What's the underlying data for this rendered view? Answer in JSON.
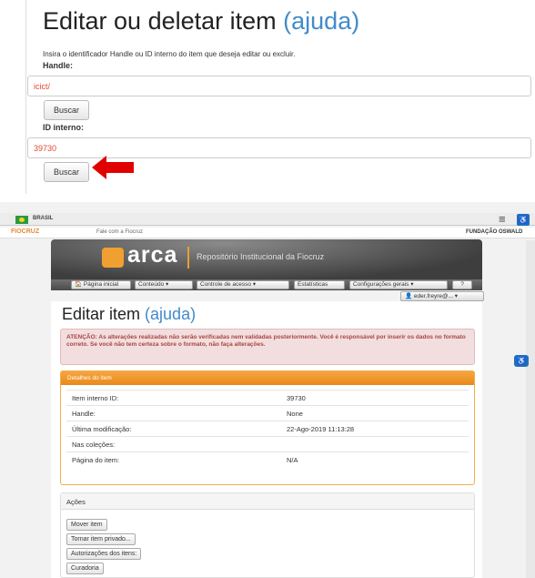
{
  "top": {
    "title": "Editar ou deletar item",
    "help": "(ajuda)",
    "intro": "Insira o identificador Handle ou ID interno do item que deseja editar ou excluir.",
    "handle_label": "Handle:",
    "handle_value": "icict/",
    "search_label": "Buscar",
    "id_label": "ID interno:",
    "id_value": "39730",
    "search2_label": "Buscar"
  },
  "govbar": {
    "country": "BRASIL"
  },
  "fiobar": {
    "logo": "FIOCRUZ",
    "contact": "Fale com a Fiocruz",
    "foundation": "FUNDAÇÃO OSWALD"
  },
  "banner": {
    "brand": "arca",
    "subtitle": "Repositório Institucional da Fiocruz"
  },
  "nav": {
    "home": "Página inicial",
    "content": "Conteúdo",
    "access": "Controle de acesso",
    "stats": "Estatísticas",
    "settings": "Configurações gerais",
    "user": "eder.freyre@..."
  },
  "page": {
    "title": "Editar item",
    "help": "(ajuda)",
    "warning": "ATENÇÃO: As alterações realizadas não serão verificadas nem validadas posteriormente. Você é responsável por inserir os dados no formato correto. Se você não tem certeza sobre o formato, não faça alterações."
  },
  "details": {
    "header": "Detalhes do item",
    "rows": [
      {
        "label": "Item interno ID:",
        "value": "39730"
      },
      {
        "label": "Handle:",
        "value": "None"
      },
      {
        "label": "Última modificação:",
        "value": "22-Ago-2019 11:13:28"
      },
      {
        "label": "Nas coleções:",
        "value": ""
      },
      {
        "label": "Página do item:",
        "value": "N/A"
      }
    ]
  },
  "actions": {
    "header": "Ações",
    "move": "Mover item",
    "private": "Tornar item privado...",
    "auth": "Autorizações dos itens:",
    "curate": "Curadoria"
  },
  "colors": {
    "accent": "#428bca",
    "warning_text": "#a94442",
    "panel_header": "#f0ad4e",
    "arrow": "#e10000"
  }
}
